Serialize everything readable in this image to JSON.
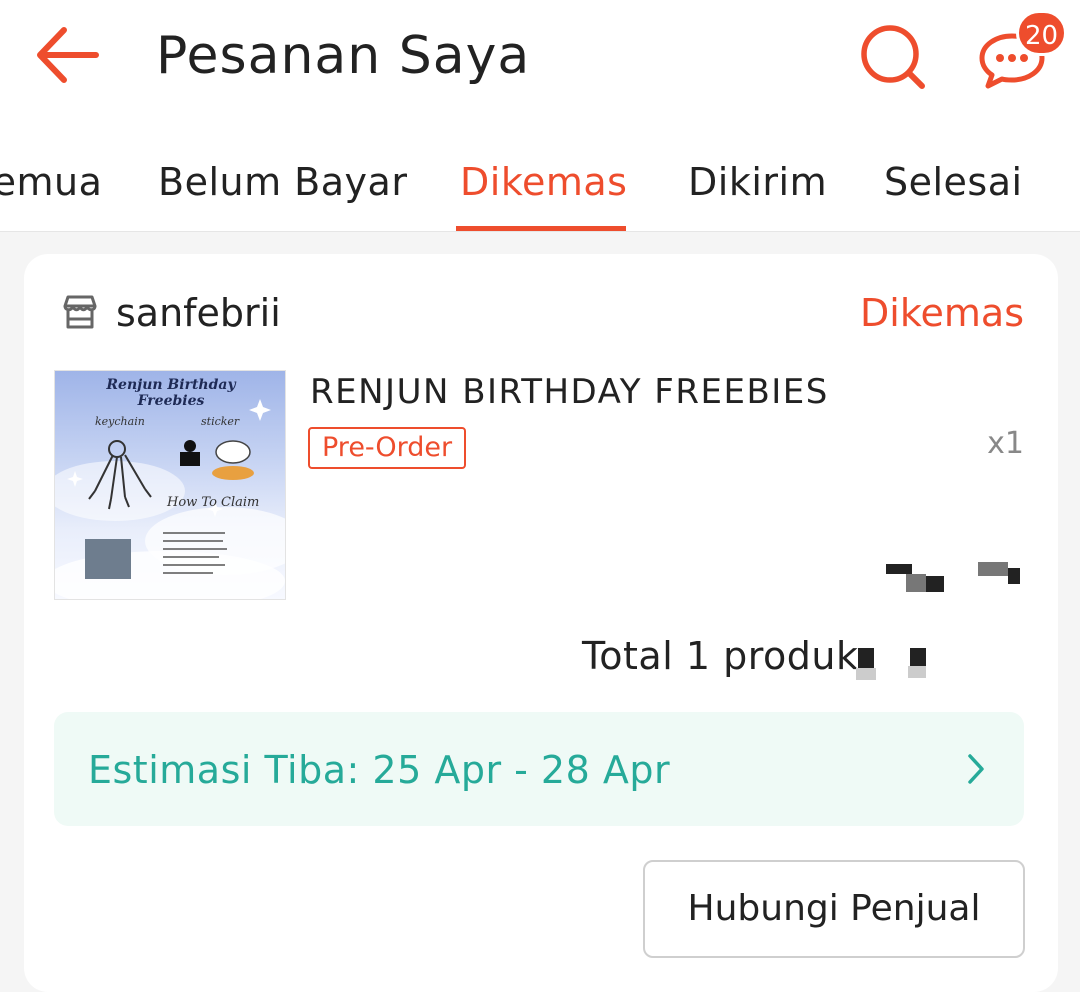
{
  "header": {
    "title": "Pesanan Saya",
    "chat_badge_count": "20",
    "back_icon": "arrow-left-icon",
    "search_icon": "search-icon",
    "chat_icon": "chat-icon"
  },
  "tabs": [
    {
      "label": "Semua"
    },
    {
      "label": "Belum Bayar"
    },
    {
      "label": "Dikemas",
      "active": true
    },
    {
      "label": "Dikirim"
    },
    {
      "label": "Selesai"
    }
  ],
  "order": {
    "shop_name": "sanfebrii",
    "status": "Dikemas",
    "product": {
      "name": "RENJUN BIRTHDAY FREEBIES",
      "badge": "Pre-Order",
      "quantity": "x1",
      "image_title": "Renjun Birthday Freebies",
      "image_labels": [
        "keychain",
        "sticker",
        "How To Claim"
      ]
    },
    "total_label": "Total 1 produk",
    "eta": "Estimasi Tiba: 25 Apr - 28 Apr",
    "contact_button": "Hubungi Penjual"
  },
  "colors": {
    "accent": "#ee4d2d",
    "eta_text": "#26aa99",
    "eta_bg": "#effaf6"
  }
}
